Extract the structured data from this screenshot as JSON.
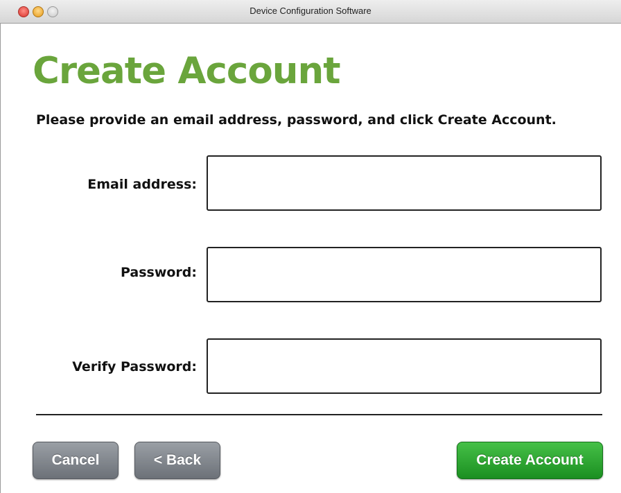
{
  "window": {
    "title": "Device Configuration Software"
  },
  "page": {
    "title": "Create Account",
    "instructions": "Please provide an email address, password, and click Create Account."
  },
  "form": {
    "email": {
      "label": "Email address:",
      "value": "",
      "placeholder": ""
    },
    "password": {
      "label": "Password:",
      "value": "",
      "placeholder": ""
    },
    "verify_password": {
      "label": "Verify Password:",
      "value": "",
      "placeholder": ""
    }
  },
  "buttons": {
    "cancel": "Cancel",
    "back": "< Back",
    "create": "Create Account"
  },
  "colors": {
    "title_green": "#6aa53c",
    "create_button_green": "#2aa02f",
    "secondary_button_gray": "#80858c"
  }
}
